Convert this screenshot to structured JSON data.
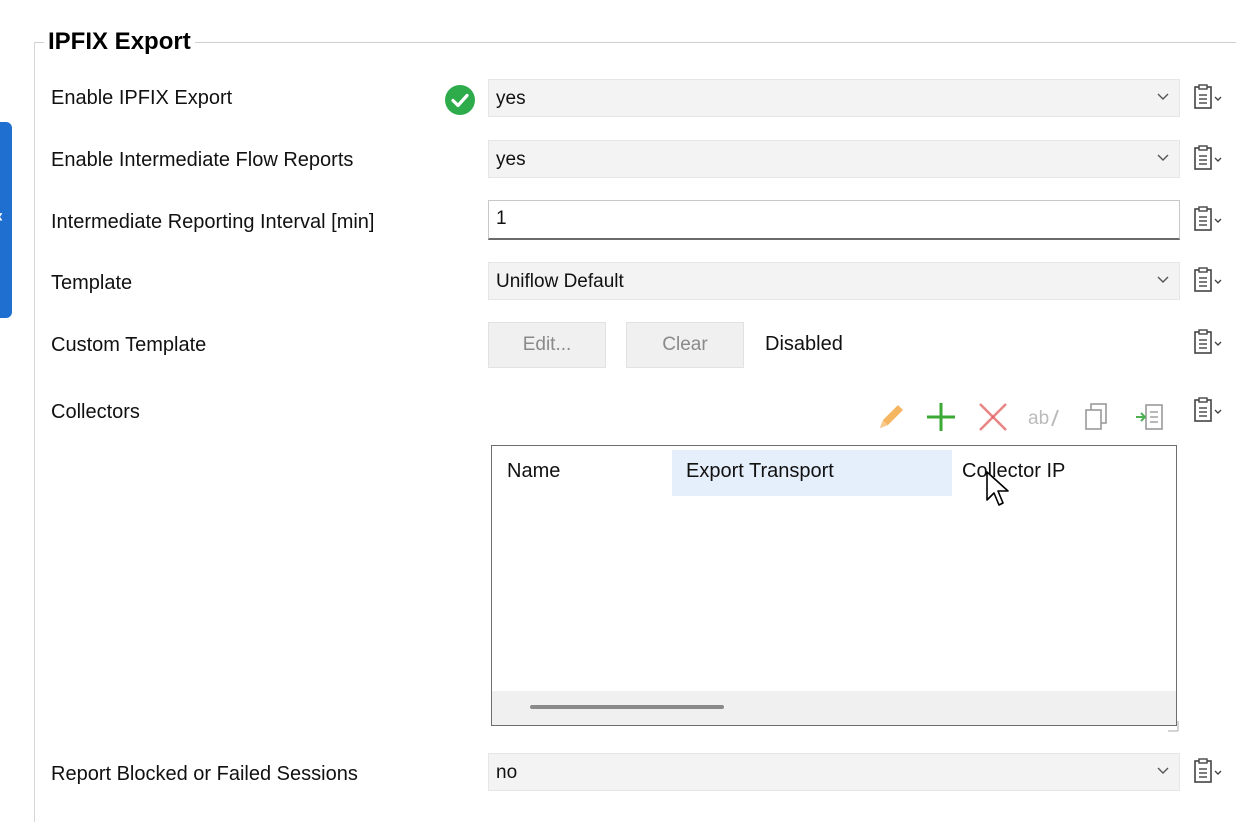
{
  "group": {
    "title": "IPFIX Export"
  },
  "fields": {
    "enable_export": {
      "label": "Enable IPFIX Export",
      "value": "yes"
    },
    "intermediate_reports": {
      "label": "Enable Intermediate Flow Reports",
      "value": "yes"
    },
    "reporting_interval": {
      "label": "Intermediate Reporting Interval [min]",
      "value": "1"
    },
    "template": {
      "label": "Template",
      "value": "Uniflow Default"
    },
    "custom_template": {
      "label": "Custom Template",
      "edit_label": "Edit...",
      "clear_label": "Clear",
      "status": "Disabled"
    },
    "collectors": {
      "label": "Collectors",
      "columns": [
        "Name",
        "Export Transport",
        "Collector IP"
      ],
      "toolbar": [
        "edit-icon",
        "add-icon",
        "delete-icon",
        "rename-icon",
        "copy-icon",
        "import-icon"
      ]
    },
    "report_blocked": {
      "label": "Report Blocked or Failed Sessions",
      "value": "no"
    }
  },
  "colors": {
    "accent": "#1f6fd1",
    "check": "#2eab4a",
    "add": "#3aaa35",
    "delete": "#e35b5b",
    "edit": "#f2a33a"
  }
}
